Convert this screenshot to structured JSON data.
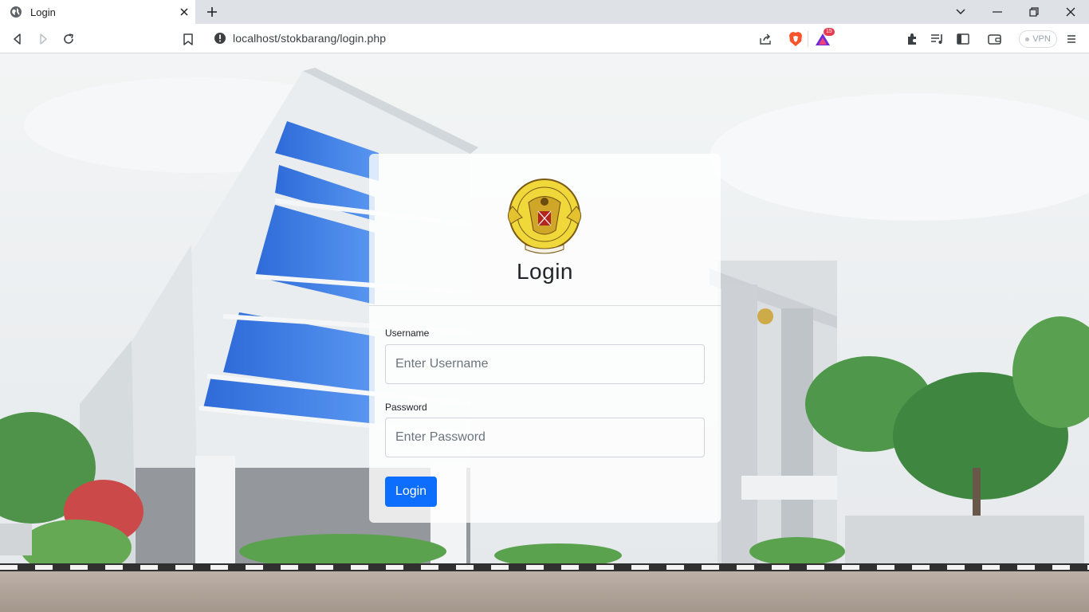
{
  "browser": {
    "tab_title": "Login",
    "url": "localhost/stokbarang/login.php",
    "vpn_label": "VPN",
    "rewards_badge": "15",
    "icons": [
      "globe-icon",
      "close-icon",
      "plus-icon",
      "chevron-down-icon",
      "minimize-icon",
      "restore-icon",
      "window-close-icon",
      "back-icon",
      "forward-icon",
      "reload-icon",
      "bookmark-icon",
      "info-icon",
      "share-icon",
      "brave-shields-icon",
      "brave-rewards-icon",
      "extensions-icon",
      "playlist-icon",
      "sidebar-icon",
      "wallet-icon",
      "menu-icon"
    ]
  },
  "login": {
    "title": "Login",
    "username_label": "Username",
    "username_placeholder": "Enter Username",
    "password_label": "Password",
    "password_placeholder": "Enter Password",
    "submit_label": "Login"
  },
  "colors": {
    "primary": "#0d6efd",
    "tabbar": "#dee1e6",
    "brave_orange": "#fb542b"
  }
}
